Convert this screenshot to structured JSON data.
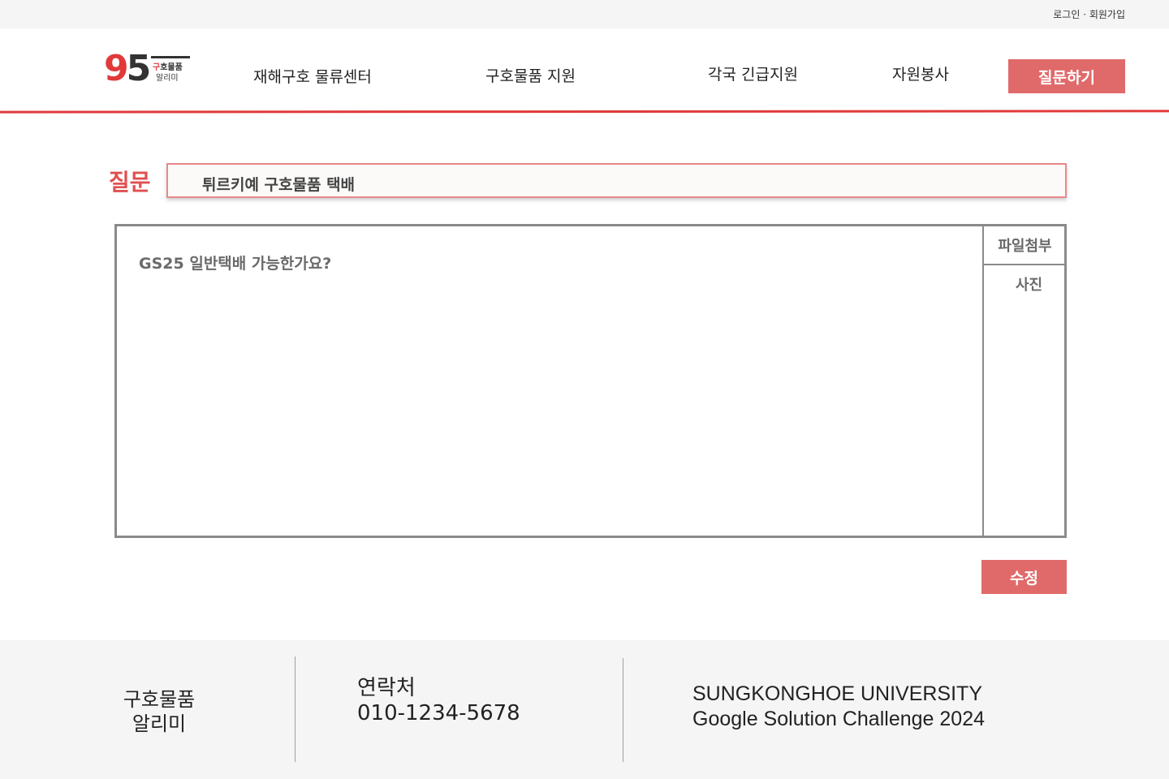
{
  "topbar": {
    "auth_links": "로그인 · 회원가입"
  },
  "logo": {
    "number_9": "9",
    "number_5": "5",
    "line1_red": "구",
    "line1_rest": "호물품",
    "line2": "알리미"
  },
  "nav": {
    "items": [
      "재해구호 물류센터",
      "구호물품 지원",
      "각국 긴급지원",
      "자원봉사"
    ],
    "ask_button": "질문하기"
  },
  "question": {
    "label": "질문",
    "title": "튀르키예 구호물품 택배",
    "body": "GS25 일반택배 가능한가요?",
    "attach_label": "파일첨부",
    "photo_label": "사진",
    "edit_button": "수정"
  },
  "footer": {
    "brand_line1": "구호물품",
    "brand_line2": "알리미",
    "contact_label": "연락처",
    "contact_phone": "010-1234-5678",
    "org_line1": "SUNGKONGHOE UNIVERSITY",
    "org_line2": "Google Solution Challenge 2024"
  },
  "colors": {
    "accent": "#e03a3a",
    "button": "#e06a6a",
    "footer_bg": "#f5f5f5",
    "border": "#8a8a8a"
  }
}
